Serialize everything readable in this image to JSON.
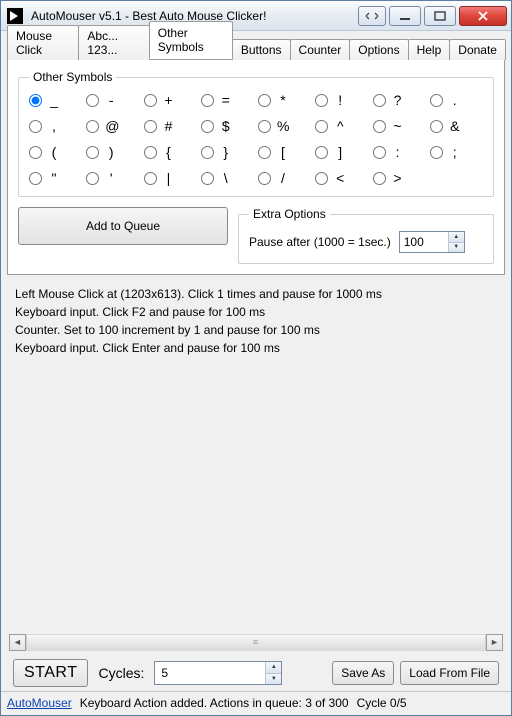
{
  "window": {
    "title": "AutoMouser v5.1 - Best Auto Mouse Clicker!"
  },
  "tabs": {
    "items": [
      {
        "label": "Mouse Click"
      },
      {
        "label": "Abc... 123..."
      },
      {
        "label": "Other Symbols"
      },
      {
        "label": "Buttons"
      },
      {
        "label": "Counter"
      },
      {
        "label": "Options"
      },
      {
        "label": "Help"
      },
      {
        "label": "Donate"
      }
    ],
    "active_index": 2
  },
  "symbols": {
    "legend": "Other Symbols",
    "selected_index": 0,
    "glyphs": [
      "_",
      "-",
      "+",
      "=",
      "*",
      "!",
      "?",
      ".",
      ",",
      "@",
      "#",
      "$",
      "%",
      "^",
      "~",
      "&",
      "(",
      ")",
      "{",
      "}",
      "[",
      "]",
      ":",
      ";",
      "\"",
      "'",
      "|",
      "\\",
      "/",
      "<",
      ">"
    ]
  },
  "add_button": {
    "label": "Add to Queue"
  },
  "extra": {
    "legend": "Extra Options",
    "pause_label": "Pause after (1000 = 1sec.)",
    "pause_value": "100"
  },
  "log": {
    "lines": [
      "Left Mouse Click at  (1203x613). Click 1 times and pause for 1000 ms",
      "Keyboard input. Click F2 and pause for 100 ms",
      "Counter. Set to 100 increment by 1 and pause for 100 ms",
      "Keyboard input. Click Enter and pause for 100 ms"
    ]
  },
  "footer": {
    "start_label": "START",
    "cycles_label": "Cycles:",
    "cycles_value": "5",
    "save_as": "Save As",
    "load_from_file": "Load From File"
  },
  "status": {
    "link": "AutoMouser",
    "message": "Keyboard Action added. Actions in queue: 3 of 300",
    "cycle": "Cycle 0/5"
  }
}
